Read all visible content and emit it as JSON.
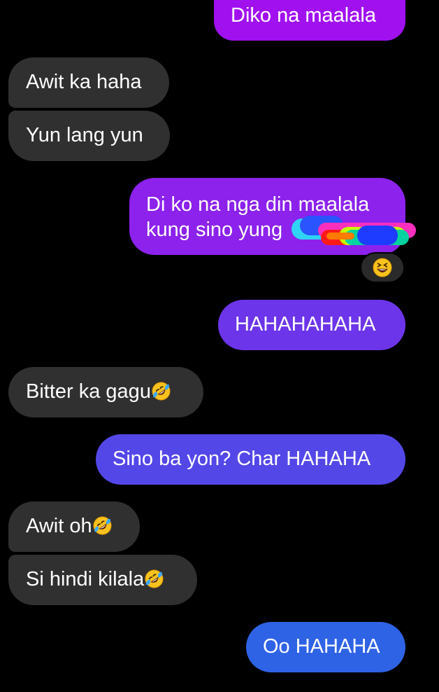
{
  "messages": [
    {
      "id": "b1",
      "side": "sent",
      "text": "Diko na maalala"
    },
    {
      "id": "b2",
      "side": "received",
      "text": "Awit ka haha"
    },
    {
      "id": "b3",
      "side": "received",
      "text": "Yun lang yun"
    },
    {
      "id": "b4",
      "side": "sent",
      "line1": "Di ko na nga din maalala",
      "line2": "kung sino yung",
      "reaction": "grinning-squinting-face"
    },
    {
      "id": "b5",
      "side": "sent",
      "text": "HAHAHAHAHA"
    },
    {
      "id": "b6",
      "side": "received",
      "text": "Bitter ka gagu",
      "emoji": "rolling-on-floor-laughing"
    },
    {
      "id": "b7",
      "side": "sent",
      "text": "Sino ba yon? Char HAHAHA"
    },
    {
      "id": "b8",
      "side": "received",
      "text": "Awit oh",
      "emoji": "rolling-on-floor-laughing"
    },
    {
      "id": "b9",
      "side": "received",
      "text": "Si hindi kilala",
      "emoji": "rolling-on-floor-laughing"
    },
    {
      "id": "b10",
      "side": "sent",
      "text": "Oo HAHAHA"
    }
  ],
  "colors": {
    "background": "#000000",
    "received_bubble": "#303030",
    "sent_gradient": [
      "#a111f0",
      "#8c22ec",
      "#6c35e9",
      "#5447e8",
      "#2f63e6"
    ]
  }
}
